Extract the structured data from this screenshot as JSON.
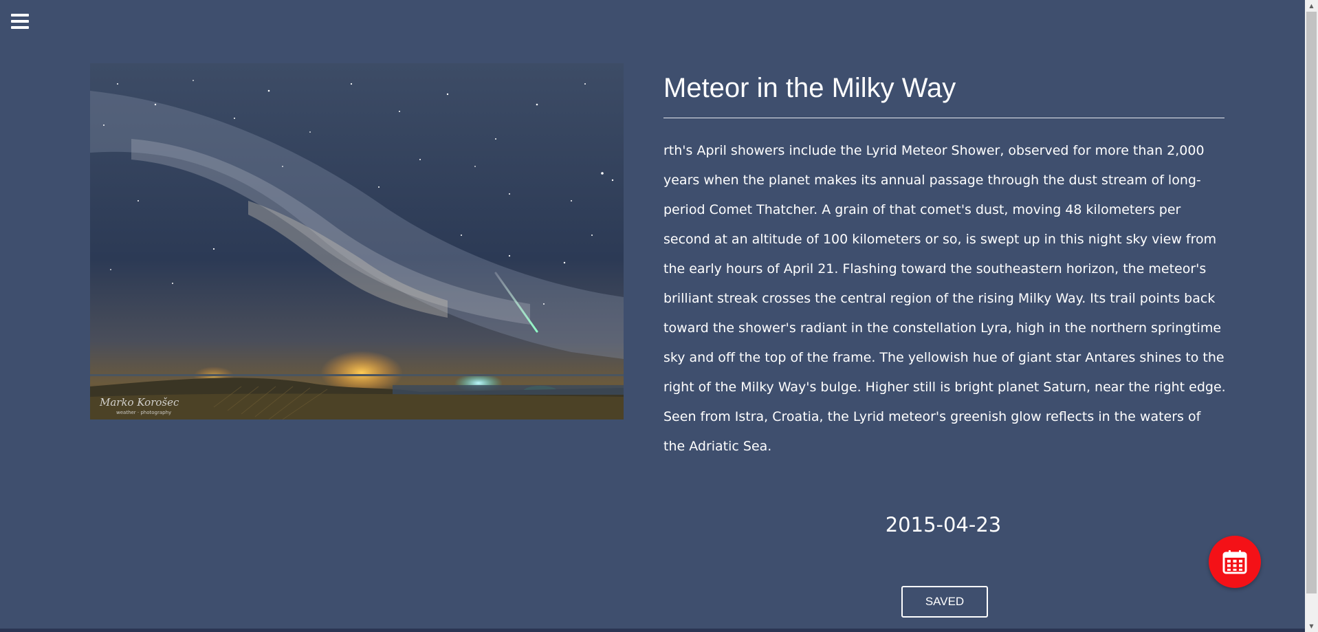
{
  "menu": {
    "icon": "hamburger-menu-icon"
  },
  "apod": {
    "title": "Meteor in the Milky Way",
    "explanation": "rth's April showers include the Lyrid Meteor Shower, observed for more than 2,000 years when the planet makes its annual passage through the dust stream of long-period Comet Thatcher. A grain of that comet's dust, moving 48 kilometers per second at an altitude of 100 kilometers or so, is swept up in this night sky view from the early hours of April 21. Flashing toward the southeastern horizon, the meteor's brilliant streak crosses the central region of the rising Milky Way. Its trail points back toward the shower's radiant in the constellation Lyra, high in the northern springtime sky and off the top of the frame. The yellowish hue of giant star Antares shines to the right of the Milky Way's bulge. Higher still is bright planet Saturn, near the right edge. Seen from Istra, Croatia, the Lyrid meteor's greenish glow reflects in the waters of the Adriatic Sea.",
    "date": "2015-04-23",
    "image_watermark": "Marko Korošec weather photography"
  },
  "actions": {
    "saved_label": "SAVED",
    "calendar_icon": "calendar-icon"
  },
  "colors": {
    "background": "#3f4f6e",
    "fab": "#f41117",
    "text": "#ffffff"
  }
}
